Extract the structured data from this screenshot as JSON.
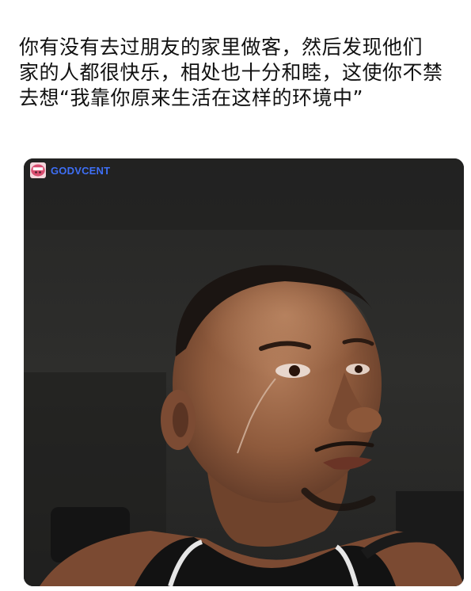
{
  "caption": {
    "lines": [
      "你有没有去过朋友的家里做客，然后发现他们",
      "家的人都很快乐，相处也十分和睦，这使你不禁",
      "去想“我靠你原来生活在这样的环境中”"
    ]
  },
  "watermark": {
    "text": "GODVCENT",
    "color": "#3e6ff5"
  },
  "photo": {
    "subject": "crying-man-in-car-photo"
  }
}
